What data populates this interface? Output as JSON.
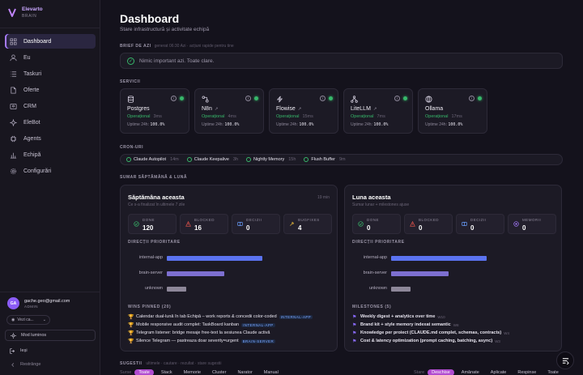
{
  "app": {
    "name": "Elevarto",
    "sub": "BRAIN"
  },
  "nav": [
    {
      "label": "Dashboard",
      "icon": "grid-icon",
      "active": true
    },
    {
      "label": "Eu",
      "icon": "user-icon"
    },
    {
      "label": "Taskuri",
      "icon": "list-icon"
    },
    {
      "label": "Oferte",
      "icon": "document-icon"
    },
    {
      "label": "CRM",
      "icon": "contacts-icon"
    },
    {
      "label": "EleBot",
      "icon": "sparkle-icon"
    },
    {
      "label": "Agents",
      "icon": "cpu-icon"
    },
    {
      "label": "Echipă",
      "icon": "chart-icon"
    },
    {
      "label": "Configurări",
      "icon": "gear-icon"
    }
  ],
  "user": {
    "initials": "GA",
    "email": "gache.geo@gmail.com",
    "role": "ADMIN"
  },
  "view_select": "Vezi ca...",
  "light_mode": "Mod luminos",
  "exit": "Ieși",
  "collapse": "Restrânge",
  "header": {
    "title": "Dashboard",
    "subtitle": "Stare infrastructură și activitate echipă"
  },
  "brief": {
    "label": "BRIEF DE AZI",
    "meta": "generat 06:30 Azi · acțiuni rapide pentru tine",
    "text": "Nimic important azi. Toate clare."
  },
  "services_label": "SERVICII",
  "services": [
    {
      "name": "Postgres",
      "status": "Operațional",
      "latency": "3ms",
      "uptime_label": "Uptime 24h:",
      "uptime": "100.0%",
      "icon": "database-icon",
      "external": false
    },
    {
      "name": "N8n",
      "status": "Operațional",
      "latency": "4ms",
      "uptime_label": "Uptime 24h:",
      "uptime": "100.0%",
      "icon": "workflow-icon",
      "external": true
    },
    {
      "name": "Flowise",
      "status": "Operațional",
      "latency": "15ms",
      "uptime_label": "Uptime 24h:",
      "uptime": "100.0%",
      "icon": "bolt-icon",
      "external": true
    },
    {
      "name": "LiteLLM",
      "status": "Operațional",
      "latency": "7ms",
      "uptime_label": "Uptime 24h:",
      "uptime": "100.0%",
      "icon": "network-icon",
      "external": true
    },
    {
      "name": "Ollama",
      "status": "Operațional",
      "latency": "17ms",
      "uptime_label": "Uptime 24h:",
      "uptime": "100.0%",
      "icon": "globe-icon",
      "external": false
    }
  ],
  "cron_label": "CRON-URI",
  "crons": [
    {
      "name": "Claude Autopilot",
      "age": "14m"
    },
    {
      "name": "Claude Keepalive",
      "age": "3h"
    },
    {
      "name": "Nightly Memory",
      "age": "15h"
    },
    {
      "name": "Flush Buffer",
      "age": "9m"
    }
  ],
  "summary_label": "SUMAR SĂPTĂMÂNĂ & LUNĂ",
  "week": {
    "title": "Săptămâna aceasta",
    "sub": "Ce s-a finalizat în ultimele 7 zile",
    "time": "19 min",
    "stats": [
      {
        "label": "DONE",
        "value": "120",
        "color": "#37b86a"
      },
      {
        "label": "BLOCKED",
        "value": "16",
        "color": "#e0524a"
      },
      {
        "label": "DECIZII",
        "value": "0",
        "color": "#6aa0ff"
      },
      {
        "label": "BUGFIXES",
        "value": "4",
        "color": "#e2b43a"
      }
    ],
    "directions_label": "DIRECȚII PRIORITARE",
    "directions": [
      {
        "name": "internal-app",
        "value": 1.0,
        "color": "#5b73f0"
      },
      {
        "name": "brain-server",
        "value": 0.6,
        "color": "#7d6fd0"
      },
      {
        "name": "unknown",
        "value": 0.2,
        "color": "#8d8799"
      }
    ],
    "wins_label": "WINS PINNED (20)",
    "wins": [
      {
        "text": "Calendar dual-lună în tab Echipă – work reports & concedii color-coded",
        "tag": "INTERNAL-APP"
      },
      {
        "text": "Mobile responsive audit complet: TaskBoard kanban",
        "tag": "INTERNAL-APP"
      },
      {
        "text": "Telegram listener: bridge mesaje free-text la sesiunea Claude activă",
        "tag": ""
      },
      {
        "text": "Silence Telegram — pastreaza doar severity=urgent",
        "tag": "BRAIN-SERVER"
      }
    ]
  },
  "month": {
    "title": "Luna aceasta",
    "sub": "Sumar lunar + milestones ajuse",
    "stats": [
      {
        "label": "DONE",
        "value": "0",
        "color": "#37b86a"
      },
      {
        "label": "BLOCKED",
        "value": "0",
        "color": "#e0524a"
      },
      {
        "label": "DECIZII",
        "value": "0",
        "color": "#6aa0ff"
      },
      {
        "label": "MEMORII",
        "value": "0",
        "color": "#a77bff"
      }
    ],
    "directions_label": "DIRECȚII PRIORITARE",
    "directions": [
      {
        "name": "internal-app",
        "value": 1.0,
        "color": "#5b73f0"
      },
      {
        "name": "brain-server",
        "value": 0.6,
        "color": "#7d6fd0"
      },
      {
        "name": "unknown",
        "value": 0.2,
        "color": "#8d8799"
      }
    ],
    "milestones_label": "MILESTONES (5)",
    "milestones": [
      {
        "text": "Weekly digest + analytics over time",
        "week": "W10"
      },
      {
        "text": "Brand kit + style memory indexat semantic",
        "week": "W8"
      },
      {
        "text": "Knowledge per proiect (CLAUDE.md complet, schemas, contracts)",
        "week": "W4"
      },
      {
        "text": "Cost & latency optimization (prompt caching, batching, async)",
        "week": "W3"
      }
    ]
  },
  "suggestions": {
    "label": "SUGESTII",
    "meta": "ultimele · cautare · rezultat · stare sugestii",
    "left_prefix": "Surse",
    "left": [
      "Toate",
      "Stack",
      "Memorie",
      "Cluster",
      "Narator",
      "Manual"
    ],
    "right_prefix": "Stare",
    "right": [
      "Deschise",
      "Amânate",
      "Aplicate",
      "Respinse",
      "Toate"
    ]
  }
}
